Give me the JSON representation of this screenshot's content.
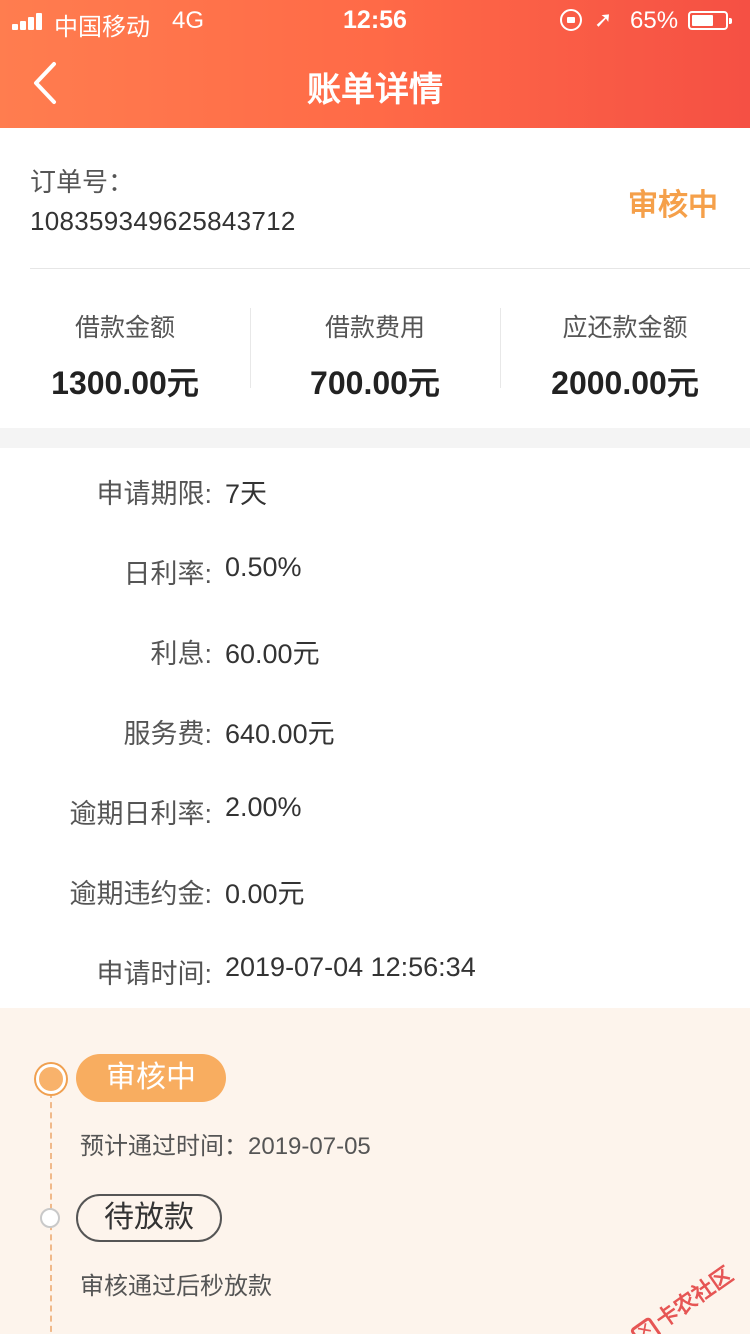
{
  "status_bar": {
    "carrier": "中国移动",
    "network": "4G",
    "time": "12:56",
    "battery_percent": "65%",
    "battery_level": 0.65
  },
  "nav": {
    "title": "账单详情",
    "back_icon": "chevron-left-icon"
  },
  "order": {
    "label": "订单号：",
    "number": "108359349625843712",
    "status": "审核中",
    "status_color": "#f5a04a"
  },
  "amounts": [
    {
      "label": "借款金额",
      "value": "1300.00元"
    },
    {
      "label": "借款费用",
      "value": "700.00元"
    },
    {
      "label": "应还款金额",
      "value": "2000.00元"
    }
  ],
  "details": [
    {
      "label": "申请期限:",
      "value": "7天"
    },
    {
      "label": "日利率:",
      "value": "0.50%"
    },
    {
      "label": "利息:",
      "value": "60.00元"
    },
    {
      "label": "服务费:",
      "value": "640.00元"
    },
    {
      "label": "逾期日利率:",
      "value": "2.00%"
    },
    {
      "label": "逾期违约金:",
      "value": "0.00元"
    },
    {
      "label": "申请时间:",
      "value": "2019-07-04 12:56:34"
    }
  ],
  "timeline": {
    "steps": [
      {
        "label": "审核中",
        "desc": "预计通过时间：2019-07-05",
        "active": true
      },
      {
        "label": "待放款",
        "desc": "审核通过后秒放款",
        "active": false
      }
    ],
    "accent_color": "#f8ad60"
  },
  "watermark": {
    "text": "卡农社区"
  }
}
